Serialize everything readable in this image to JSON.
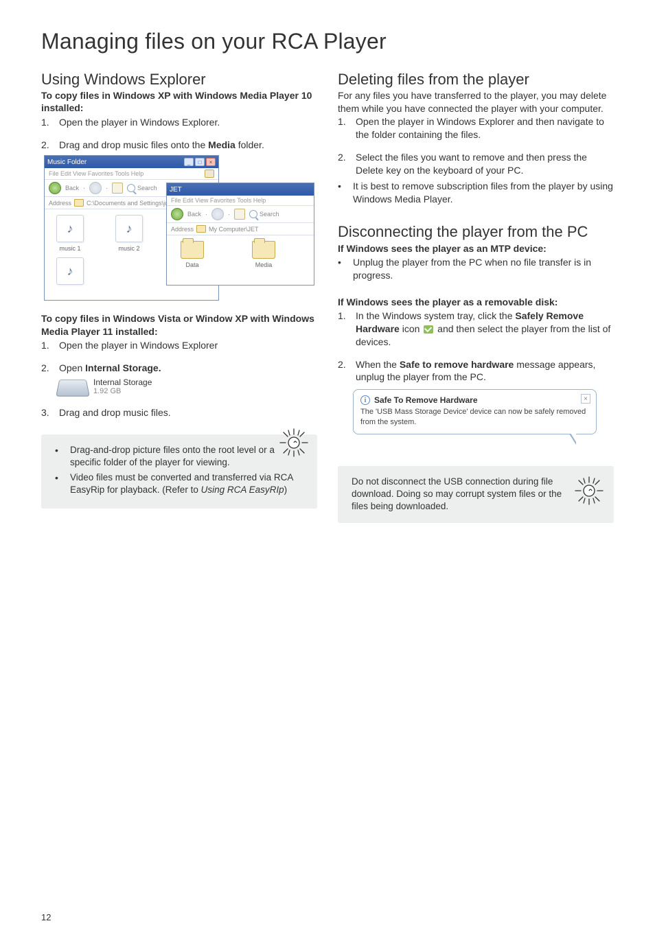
{
  "page_number": "12",
  "title": "Managing files on your RCA Player",
  "left": {
    "section1": {
      "heading": "Using Windows Explorer",
      "sub1": "To copy files in Windows XP with Windows Media Player 10 installed:",
      "step1_num": "1.",
      "step1": "Open the player in Windows Explorer.",
      "step2_num": "2.",
      "step2_pre": "Drag and drop music files onto the ",
      "step2_bold": "Media",
      "step2_post": " folder.",
      "screenshot": {
        "win1_title": "Music Folder",
        "win2_title": "JET",
        "menu_items": "File   Edit   View   Favorites   Tools   Help",
        "back": "Back",
        "search": "Search",
        "addr_label": "Address",
        "addr1": "C:\\Documents and Settings\\jd\\Desk",
        "addr2": "My Computer\\JET",
        "file_music1": "music 1",
        "file_music2": "music 2",
        "file_data": "Data",
        "file_media": "Media"
      },
      "sub2": "To copy files in Windows Vista or Window XP with Windows Media Player 11 installed:",
      "s2_step1_num": "1.",
      "s2_step1": "Open the player in Windows Explorer",
      "s2_step2_num": "2.",
      "s2_step2_pre": "Open ",
      "s2_step2_bold": "Internal Storage.",
      "drive_line1": "Internal Storage",
      "drive_line2": "1.92 GB",
      "s2_step3_num": "3.",
      "s2_step3": "Drag and drop music files."
    },
    "note": {
      "b1": "Drag-and-drop picture files onto the root level or a specific folder of the player for viewing.",
      "b2_pre": "Video files must be converted and transferred via RCA EasyRip for playback. (Refer to ",
      "b2_ital": "Using RCA EasyRIp",
      "b2_post": ")"
    }
  },
  "right": {
    "section1": {
      "heading": "Deleting files from the player",
      "intro": "For any files you have transferred to the player, you may delete them while you have connected the player with your computer.",
      "step1_num": "1.",
      "step1": "Open the player in Windows Explorer and then navigate to the folder containing the files.",
      "step2_num": "2.",
      "step2": "Select the files you want to remove and then press the Delete key on the keyboard of your PC.",
      "bullet1": "It is best to remove subscription files from the player by using Windows Media Player."
    },
    "section2": {
      "heading": "Disconnecting the player from the PC",
      "sub1": "If Windows sees the player as an MTP device:",
      "b1": "Unplug the player from the PC when no file transfer is in progress.",
      "sub2": "If Windows sees the player as a removable disk:",
      "step1_num": "1.",
      "step1_pre": "In the Windows system tray, click the ",
      "step1_b1": "Safely Remove Hardware",
      "step1_mid": " icon ",
      "step1_post": " and then select the player from the list of devices.",
      "step2_num": "2.",
      "step2_pre": "When the ",
      "step2_b": "Safe to remove hardware",
      "step2_post": " message appears, unplug the player from the PC.",
      "balloon_title": "Safe To Remove Hardware",
      "balloon_body": "The 'USB Mass Storage Device' device can now be safely removed from the system."
    },
    "note": {
      "text": "Do not disconnect the USB connection during file download. Doing so may corrupt system files or the files being downloaded."
    }
  }
}
